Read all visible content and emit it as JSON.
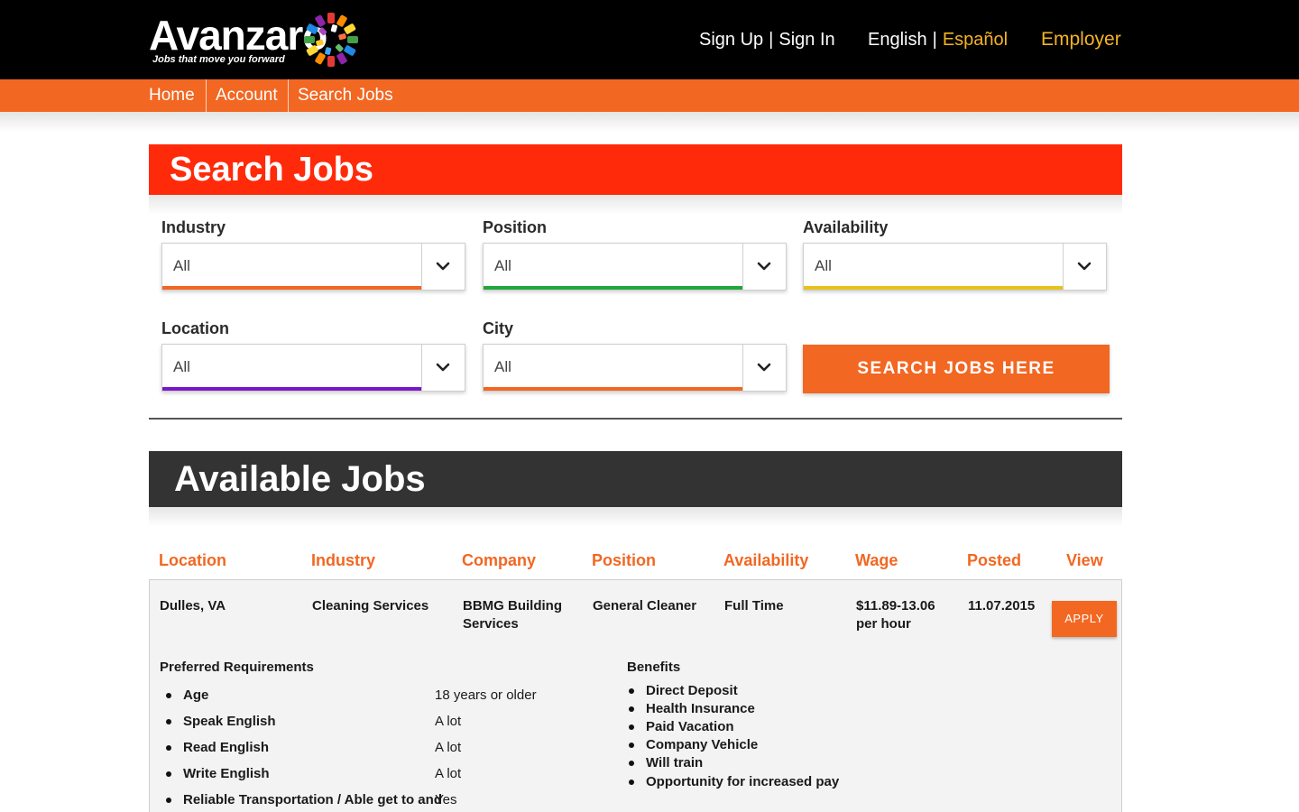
{
  "brand": {
    "name": "Avanzaro",
    "tagline": "Jobs that move you forward"
  },
  "header": {
    "sign_up": "Sign Up",
    "sign_in": "Sign In",
    "separator": "|",
    "lang_en": "English",
    "lang_es": "Español",
    "employer": "Employer"
  },
  "nav": {
    "items": [
      "Home",
      "Account",
      "Search Jobs"
    ]
  },
  "search": {
    "title": "Search Jobs",
    "fields": [
      {
        "label": "Industry",
        "value": "All",
        "accent": "#f26722"
      },
      {
        "label": "Position",
        "value": "All",
        "accent": "#1fa83a"
      },
      {
        "label": "Availability",
        "value": "All",
        "accent": "#e8c21a"
      },
      {
        "label": "Location",
        "value": "All",
        "accent": "#7a16c9"
      },
      {
        "label": "City",
        "value": "All",
        "accent": "#f26722"
      }
    ],
    "button": "SEARCH JOBS HERE"
  },
  "jobs": {
    "title": "Available Jobs",
    "columns": [
      "Location",
      "Industry",
      "Company",
      "Position",
      "Availability",
      "Wage",
      "Posted",
      "View"
    ],
    "rows": [
      {
        "location": "Dulles, VA",
        "industry": "Cleaning Services",
        "company_line1": "BBMG Building",
        "company_line2": "Services",
        "position": "General Cleaner",
        "availability": "Full Time",
        "wage_line1": "$11.89-13.06",
        "wage_line2": "per hour",
        "posted": "11.07.2015",
        "apply": "APPLY",
        "requirements_title": "Preferred Requirements",
        "requirements": [
          {
            "name": "Age",
            "value": "18 years or older"
          },
          {
            "name": "Speak English",
            "value": "A lot"
          },
          {
            "name": "Read English",
            "value": "A lot"
          },
          {
            "name": "Write English",
            "value": "A lot"
          },
          {
            "name": "Reliable Transportation / Able get to and",
            "value": "Yes"
          }
        ],
        "benefits_title": "Benefits",
        "benefits": [
          "Direct Deposit",
          "Health Insurance",
          "Paid Vacation",
          "Company Vehicle",
          "Will train",
          "Opportunity for increased pay"
        ]
      }
    ]
  },
  "colors": {
    "primary_orange": "#f26722",
    "search_red": "#ff2a0a",
    "dark_header": "#333333",
    "gold": "#f5b323"
  }
}
